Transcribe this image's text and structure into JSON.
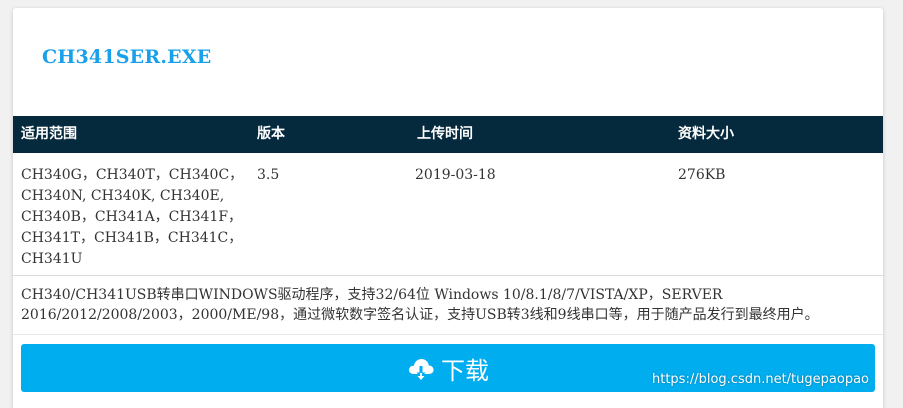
{
  "file": {
    "name": "CH341SER.EXE"
  },
  "table": {
    "headers": [
      "适用范围",
      "版本",
      "上传时间",
      "资料大小"
    ],
    "row": {
      "models": "CH340G，CH340T，CH340C，CH340N, CH340K, CH340E, CH340B，CH341A，CH341F，CH341T，CH341B，CH341C，CH341U",
      "version": "3.5",
      "upload_date": "2019-03-18",
      "size": "276KB"
    }
  },
  "description": "CH340/CH341USB转串口WINDOWS驱动程序，支持32/64位 Windows 10/8.1/8/7/VISTA/XP，SERVER 2016/2012/2008/2003，2000/ME/98，通过微软数字签名认证，支持USB转3线和9线串口等，用于随产品发行到最终用户。",
  "download": {
    "label": "下载",
    "icon": "cloud-download-icon"
  },
  "watermark": "https://blog.csdn.net/tugepaopao",
  "colors": {
    "title": "#18a0ea",
    "header_bg": "#05293d",
    "button_bg": "#00aef0"
  }
}
